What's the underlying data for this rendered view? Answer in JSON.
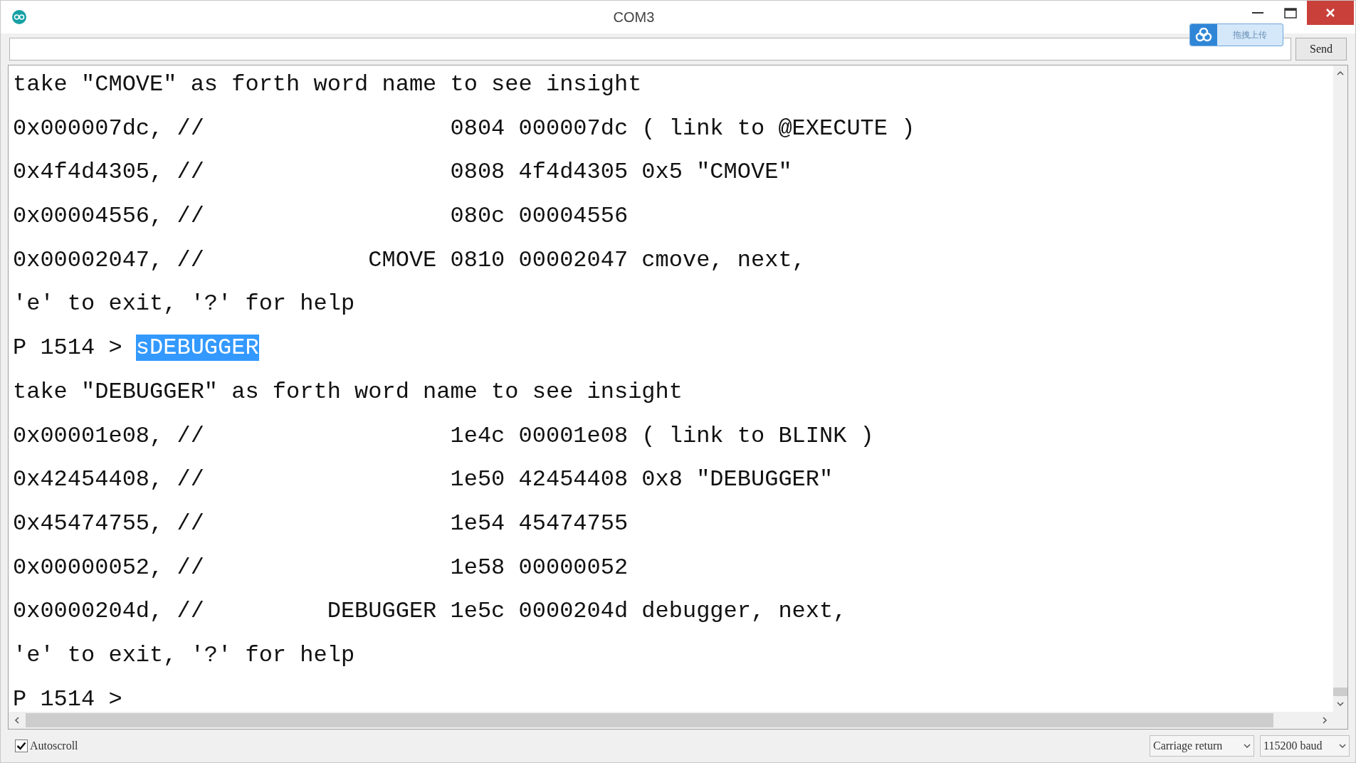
{
  "window": {
    "title": "COM3"
  },
  "send_button": "Send",
  "upload_widget": {
    "label": "拖拽上传"
  },
  "output_lines": [
    {
      "text": "take \"CMOVE\" as forth word name to see insight"
    },
    {
      "text": "0x000007dc, //                  0804 000007dc ( link to @EXECUTE )"
    },
    {
      "text": "0x4f4d4305, //                  0808 4f4d4305 0x5 \"CMOVE\""
    },
    {
      "text": "0x00004556, //                  080c 00004556"
    },
    {
      "text": "0x00002047, //            CMOVE 0810 00002047 cmove, next,"
    },
    {
      "text": "'e' to exit, '?' for help"
    },
    {
      "text": "P 1514 > ",
      "selected_text": "sDEBUGGER"
    },
    {
      "text": "take \"DEBUGGER\" as forth word name to see insight"
    },
    {
      "text": "0x00001e08, //                  1e4c 00001e08 ( link to BLINK )"
    },
    {
      "text": "0x42454408, //                  1e50 42454408 0x8 \"DEBUGGER\""
    },
    {
      "text": "0x45474755, //                  1e54 45474755"
    },
    {
      "text": "0x00000052, //                  1e58 00000052"
    },
    {
      "text": "0x0000204d, //         DEBUGGER 1e5c 0000204d debugger, next,"
    },
    {
      "text": "'e' to exit, '?' for help"
    },
    {
      "text": "P 1514 >"
    }
  ],
  "autoscroll": {
    "label": "Autoscroll",
    "checked": true
  },
  "line_ending": {
    "value": "Carriage return"
  },
  "baud_rate": {
    "value": "115200 baud"
  }
}
